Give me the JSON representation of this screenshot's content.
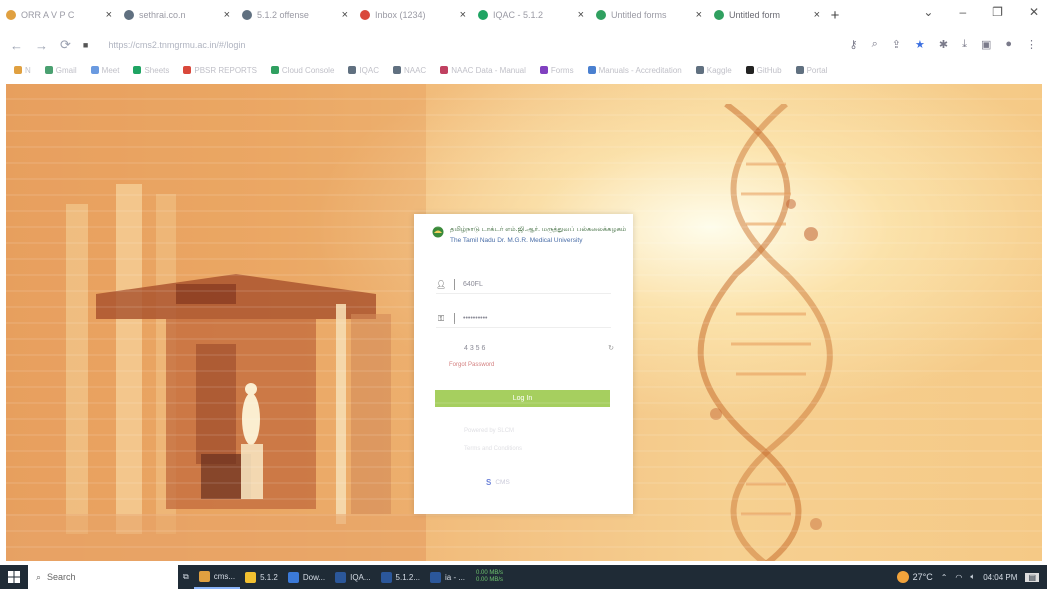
{
  "browser": {
    "tabs": [
      {
        "title": "ORR A V P C",
        "color": "#e0a040"
      },
      {
        "title": "sethrai.co.n",
        "color": "#607080"
      },
      {
        "title": "5.1.2 offense",
        "color": "#607080"
      },
      {
        "title": "Inbox (1234)",
        "color": "#d9483b"
      },
      {
        "title": "IQAC - 5.1.2",
        "color": "#1fa463"
      },
      {
        "title": "Untitled forms",
        "color": "#30a060"
      },
      {
        "title": "Untitled form",
        "color": "#30a060",
        "active": true
      }
    ],
    "new_tab": "+",
    "close_tab": "×",
    "window_controls": [
      "⌄",
      "–",
      "❐",
      "✕"
    ],
    "address": {
      "url": "https://cms2.tnmgrmu.ac.in/#/login"
    },
    "bookmarks": [
      {
        "label": "N",
        "color": "#e0a040"
      },
      {
        "label": "Gmail",
        "color": "#4aa070"
      },
      {
        "label": "Meet",
        "color": "#6a9ae0"
      },
      {
        "label": "Sheets",
        "color": "#1fa463"
      },
      {
        "label": "PBSR REPORTS",
        "color": "#d9483b"
      },
      {
        "label": "Cloud Console",
        "color": "#30a060"
      },
      {
        "label": "IQAC",
        "color": "#607080"
      },
      {
        "label": "NAAC",
        "color": "#607080"
      },
      {
        "label": "NAAC Data - Manual",
        "color": "#c04060"
      },
      {
        "label": "Forms",
        "color": "#8040c0"
      },
      {
        "label": "Manuals - Accreditation",
        "color": "#4a80d0"
      },
      {
        "label": "Kaggle",
        "color": "#607080"
      },
      {
        "label": "GitHub",
        "color": "#222222"
      },
      {
        "label": "Portal",
        "color": "#607080"
      }
    ]
  },
  "login": {
    "university_tamil": "தமிழ்நாடு டாக்டர் எம்.ஜி.ஆர். மருத்துவப் பல்கலைக்கழகம்",
    "university_english": "The Tamil Nadu Dr. M.G.R. Medical University",
    "username_value": "640FL",
    "password_value": "••••••••••",
    "captcha_value": "4 3 5 6",
    "forgot_text": "Forgot Password",
    "login_button": "Log In",
    "footer_line1": "Powered by SLCM",
    "footer_line2": "Terms and Conditions",
    "brand": "CMS",
    "brand_symbol": "S"
  },
  "taskbar": {
    "search_placeholder": "Search",
    "items": [
      {
        "label": "cms...",
        "color": "#e0a040",
        "active": true
      },
      {
        "label": "5.1.2",
        "color": "#f2c030"
      },
      {
        "label": "Dow...",
        "color": "#3b7ad9"
      },
      {
        "label": "IQA...",
        "color": "#2b579a"
      },
      {
        "label": "5.1.2...",
        "color": "#2b579a"
      },
      {
        "label": "ia - ...",
        "color": "#2b579a"
      }
    ],
    "network_up": "0.00 MB/s",
    "network_down": "0.00 MB/s",
    "temperature": "27°C",
    "time": "04:04 PM"
  }
}
